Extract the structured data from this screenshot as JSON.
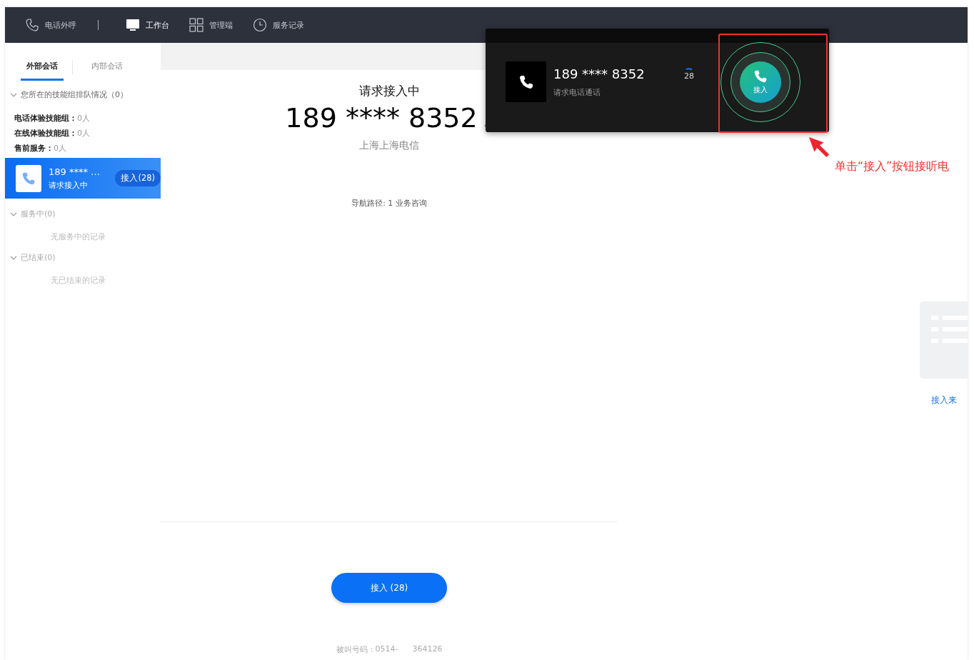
{
  "top_nav": {
    "items": [
      {
        "label": "电话外呼",
        "kind": "phone",
        "selected": false
      },
      {
        "label": "工作台",
        "kind": "monitor",
        "selected": true
      },
      {
        "label": "管理端",
        "kind": "grid",
        "selected": false
      },
      {
        "label": "服务记录",
        "kind": "clock",
        "selected": false
      }
    ]
  },
  "sidebar": {
    "tabs": [
      {
        "label": "外部会话",
        "selected": true
      },
      {
        "label": "内部会话",
        "selected": false
      }
    ],
    "queue": {
      "title": "您所在的技能组排队情况（0）",
      "expanded": true,
      "groups": [
        {
          "name": "电话体验技能组：",
          "count": "0人"
        },
        {
          "name": "在线体验技能组：",
          "count": "0人"
        },
        {
          "name": "售前服务：",
          "count": "0人"
        }
      ]
    },
    "active_call": {
      "number": "189 **** …",
      "status": "请求接入中",
      "button": "接入(28)",
      "selected": true
    },
    "sections": [
      {
        "title": "服务中(0)",
        "expanded": true,
        "empty_text": "无服务中的记录"
      },
      {
        "title": "已结束(0)",
        "expanded": true,
        "empty_text": "无已结束的记录"
      }
    ]
  },
  "main": {
    "title": "请求接入中",
    "number": "189 **** 8352",
    "location": "上海上海电信",
    "nav_path": "导航路径: 1 业务咨询",
    "accept_button": "接入 (28)",
    "callee_label": "被叫号码：",
    "callee_parts": [
      "0514-",
      "364126"
    ]
  },
  "popup": {
    "number": "189 **** 8352",
    "subtitle": "请求电话通话",
    "countdown": "28",
    "accept_label": "接入"
  },
  "annotation": {
    "text": "单击“接入”按钮接听电"
  },
  "right_panel": {
    "empty_label": "接入来"
  }
}
